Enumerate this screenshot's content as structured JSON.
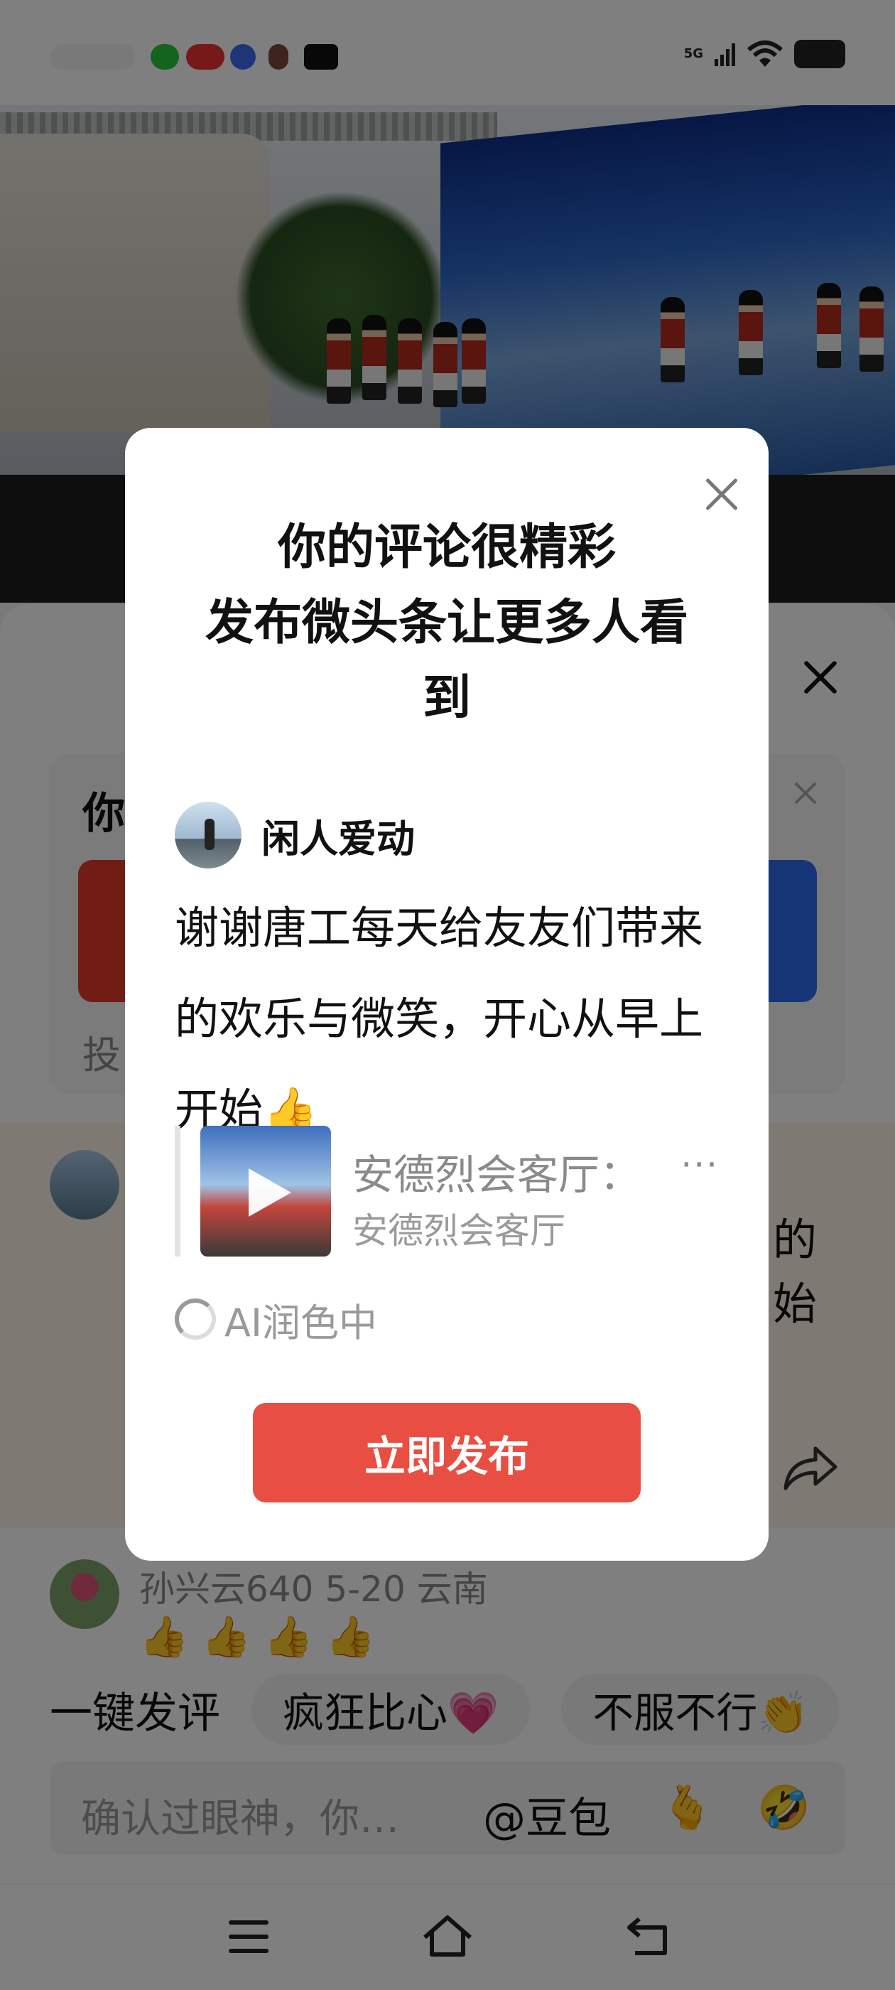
{
  "status_bar": {
    "network": "5G"
  },
  "sheet": {
    "vote_title_fragment": "你",
    "vote_footer_fragment": "投",
    "highlight_text_line1": "的",
    "highlight_text_line2": "始"
  },
  "comment2": {
    "meta": "孙兴云640  5-20  云南",
    "thumbs": "👍 👍 👍 👍"
  },
  "quick_replies": {
    "label": "一键发评",
    "pills": [
      "疯狂比心💗",
      "不服不行👏"
    ]
  },
  "input_bar": {
    "placeholder": "确认过眼神，你…",
    "mention": "@豆包",
    "emoji1": "🫰",
    "emoji2": "🤣"
  },
  "modal": {
    "title": "你的评论很精彩\n发布微头条让更多人看到",
    "title_line1": "你的评论很精彩",
    "title_line2": "发布微头条让更多人看",
    "title_line3": "到",
    "author_name": "闲人爱动",
    "comment_text": "谢谢唐工每天给友友们带来的欢乐与微笑，开心从早上开始",
    "comment_emoji": "👍",
    "share_title": "安德烈会客厅：",
    "share_ellipsis": "···",
    "share_subtitle": "安德烈会客厅",
    "ai_status": "AI润色中",
    "publish_label": "立即发布"
  },
  "colors": {
    "publish": "#e94e42",
    "dim_overlay": "rgba(0,0,0,0.5)"
  }
}
